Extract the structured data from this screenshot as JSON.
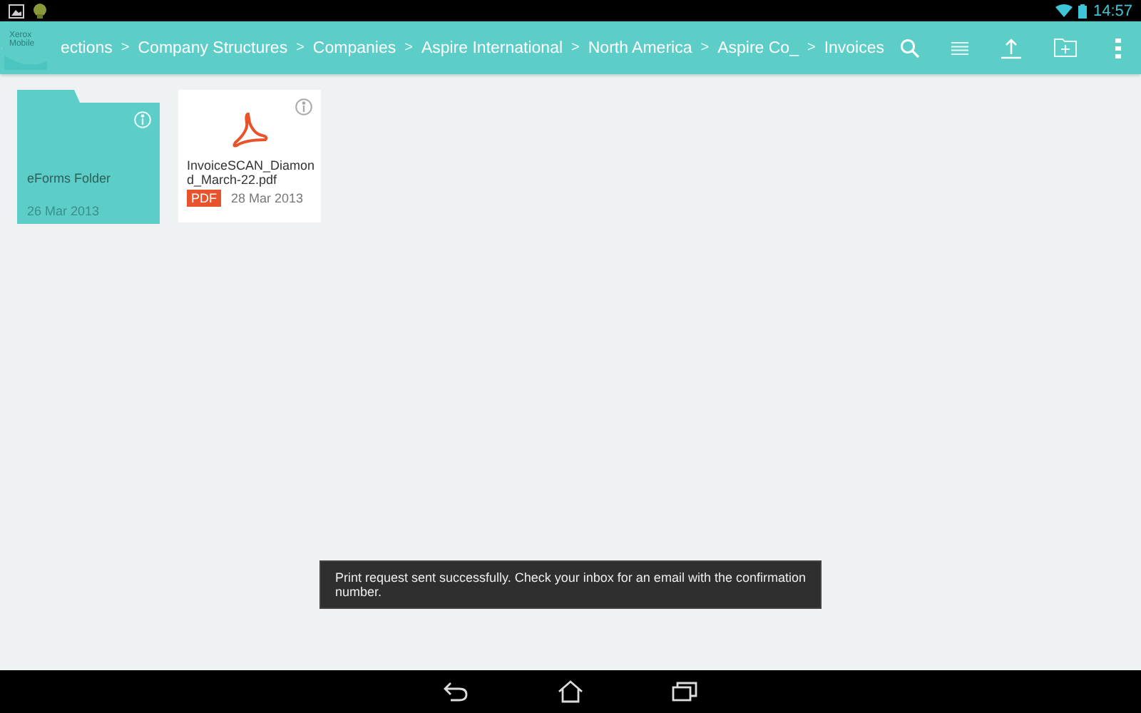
{
  "status_bar": {
    "time": "14:57"
  },
  "app_logo": {
    "lines": [
      "Xerox",
      "Mobile"
    ]
  },
  "breadcrumbs": [
    {
      "label": "ections"
    },
    {
      "label": "Company Structures"
    },
    {
      "label": "Companies"
    },
    {
      "label": "Aspire International"
    },
    {
      "label": "North America"
    },
    {
      "label": "Aspire Co_"
    },
    {
      "label": "Invoices"
    }
  ],
  "breadcrumb_separator": ">",
  "items": [
    {
      "kind": "folder",
      "name": "eForms Folder",
      "date": "26 Mar 2013"
    },
    {
      "kind": "pdf",
      "name": "InvoiceSCAN_Diamond_March-22.pdf",
      "badge": "PDF",
      "date": "28 Mar 2013"
    }
  ],
  "toast": "Print request sent successfully. Check your inbox for an email with the confirmation number."
}
